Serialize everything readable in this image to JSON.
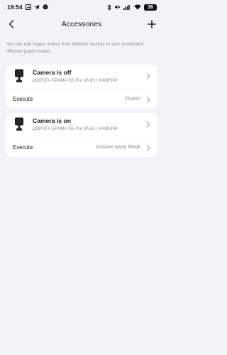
{
  "status_bar": {
    "time": "19:54",
    "battery": "36",
    "icons": [
      "photo-icon",
      "telegram-icon",
      "messenger-icon",
      "bluetooth-icon",
      "mute-icon",
      "signal-icon",
      "wifi-icon",
      "battery-icon"
    ]
  },
  "header": {
    "title": "Accessories",
    "back_icon": "chevron-left-icon",
    "add_icon": "plus-icon"
  },
  "info": "You can add trigger events from different devices to auto arm/disarm different guard modes",
  "cards": [
    {
      "title": "Camera is off",
      "subtitle": "ДОРОГА БРАМА G5 Pro (PoE) | КАМЕРИ",
      "execute_label": "Execute",
      "execute_value": "Disarm"
    },
    {
      "title": "Camera is on",
      "subtitle": "ДОРОГА БРАМА G5 Pro (PoE) | КАМЕРИ",
      "execute_label": "Execute",
      "execute_value": "Activate Away Mode"
    }
  ],
  "colors": {
    "background": "#f2f3f6",
    "card": "#ffffff",
    "secondary_text": "#8a8d93"
  }
}
